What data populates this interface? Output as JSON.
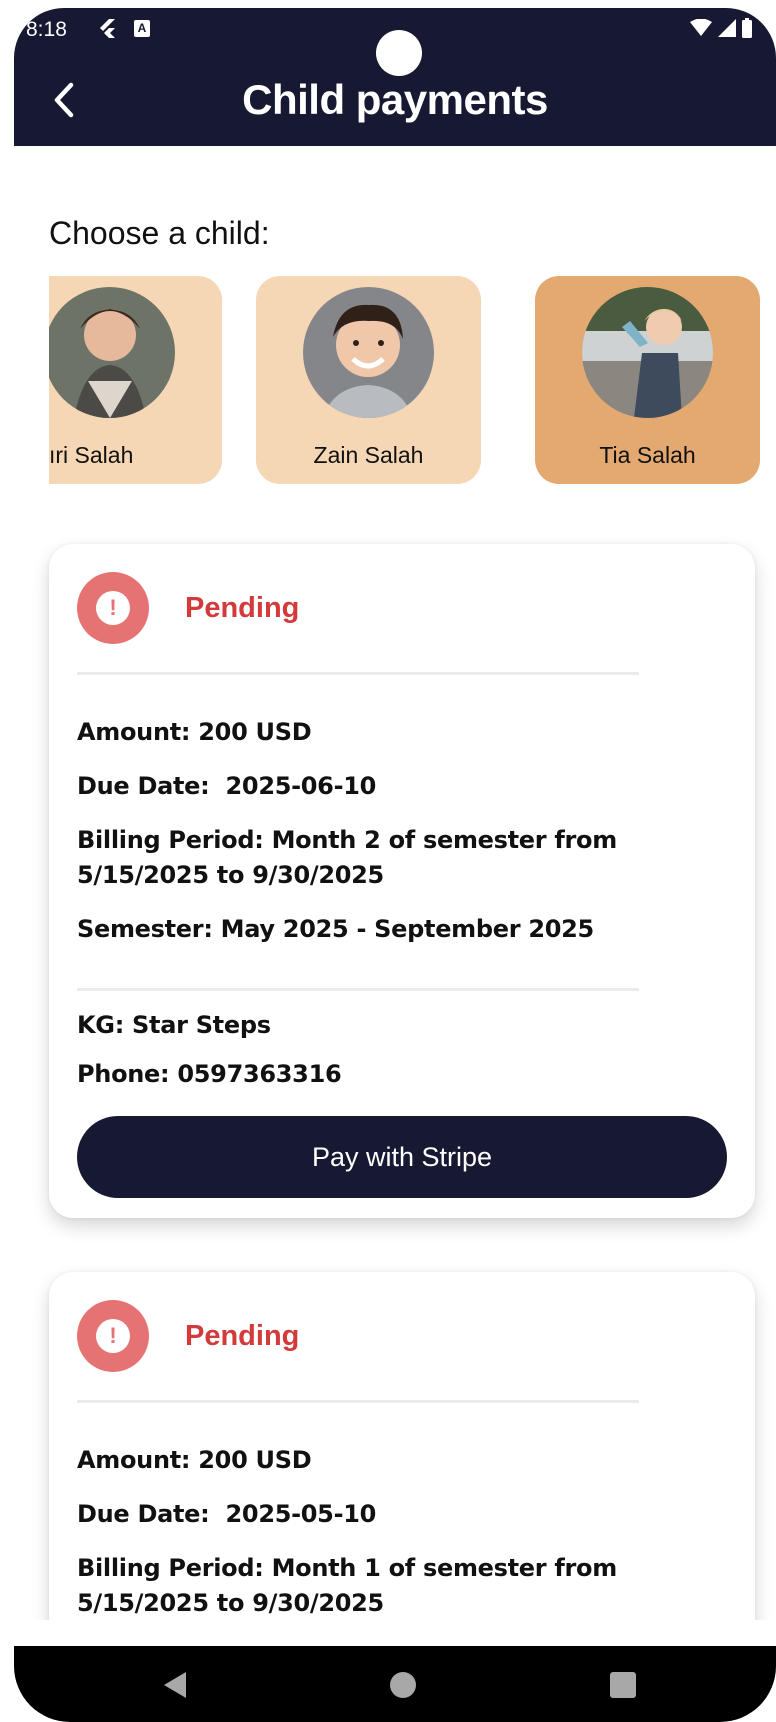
{
  "status_bar": {
    "time": "8:18"
  },
  "header": {
    "title": "Child payments"
  },
  "chooser": {
    "label": "Choose a child:",
    "children": [
      {
        "name": "Nouri Salah",
        "visible_name": "ıri Salah",
        "selected": false
      },
      {
        "name": "Zain Salah",
        "visible_name": "Zain Salah",
        "selected": false
      },
      {
        "name": "Tia Salah",
        "visible_name": "Tia Salah",
        "selected": true
      }
    ]
  },
  "payments": [
    {
      "status": "Pending",
      "amount": "Amount: 200 USD",
      "due_date": "Due Date:  2025-06-10",
      "billing_period": "Billing Period: Month 2 of semester from 5/15/2025 to 9/30/2025",
      "semester": "Semester: May 2025 - September 2025",
      "kg": "KG: Star Steps",
      "phone": "Phone: 0597363316",
      "pay_label": "Pay with Stripe"
    },
    {
      "status": "Pending",
      "amount": "Amount: 200 USD",
      "due_date": "Due Date:  2025-05-10",
      "billing_period": "Billing Period: Month 1 of semester from 5/15/2025 to 9/30/2025"
    }
  ],
  "colors": {
    "primary": "#171933",
    "pending": "#d33a3a",
    "pending_icon": "#e57373",
    "child_card": "#f5d6b5",
    "child_card_selected": "#e3a970"
  }
}
